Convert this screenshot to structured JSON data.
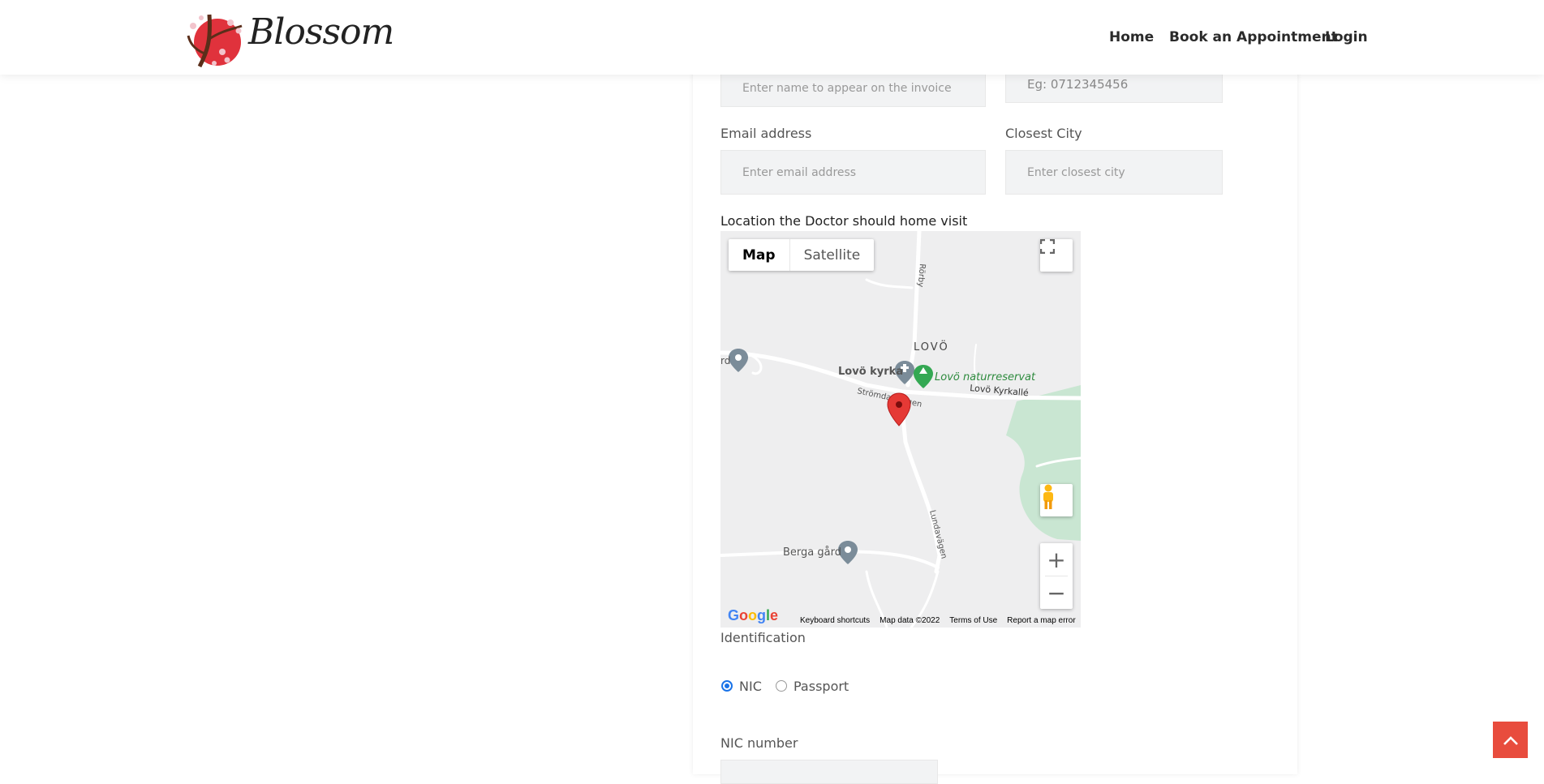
{
  "brand": {
    "name": "Blossom"
  },
  "nav": {
    "home": "Home",
    "book": "Book an Appointment",
    "login": "Login"
  },
  "form": {
    "invoice_name_placeholder": "Enter name to appear on the invoice",
    "phone_placeholder": "Eg: 0712345456",
    "email_label": "Email address",
    "email_placeholder": "Enter email address",
    "city_label": "Closest City",
    "city_placeholder": "Enter closest city",
    "location_label": "Location the Doctor should home visit",
    "identification_label": "Identification",
    "id_options": [
      "NIC",
      "Passport"
    ],
    "id_selected": "NIC",
    "nic_label": "NIC number"
  },
  "map": {
    "type_map": "Map",
    "type_satellite": "Satellite",
    "area_label": "LOVÖ",
    "places": [
      "Lovö kyrka",
      "Lovö naturreservat",
      "Berga gård"
    ],
    "roads": [
      "Rörby",
      "Strömdalsvägen",
      "Lovö Kyrkallé",
      "Lundavägen"
    ],
    "partial_label": "rd",
    "google_logo": "Google",
    "keyboard_shortcuts": "Keyboard shortcuts",
    "map_data": "Map data ©2022",
    "terms": "Terms of Use",
    "report": "Report a map error"
  },
  "colors": {
    "accent": "#e84c3d",
    "radio": "#1a73e8",
    "park": "#c9e6d2",
    "pin": "#e53935"
  }
}
